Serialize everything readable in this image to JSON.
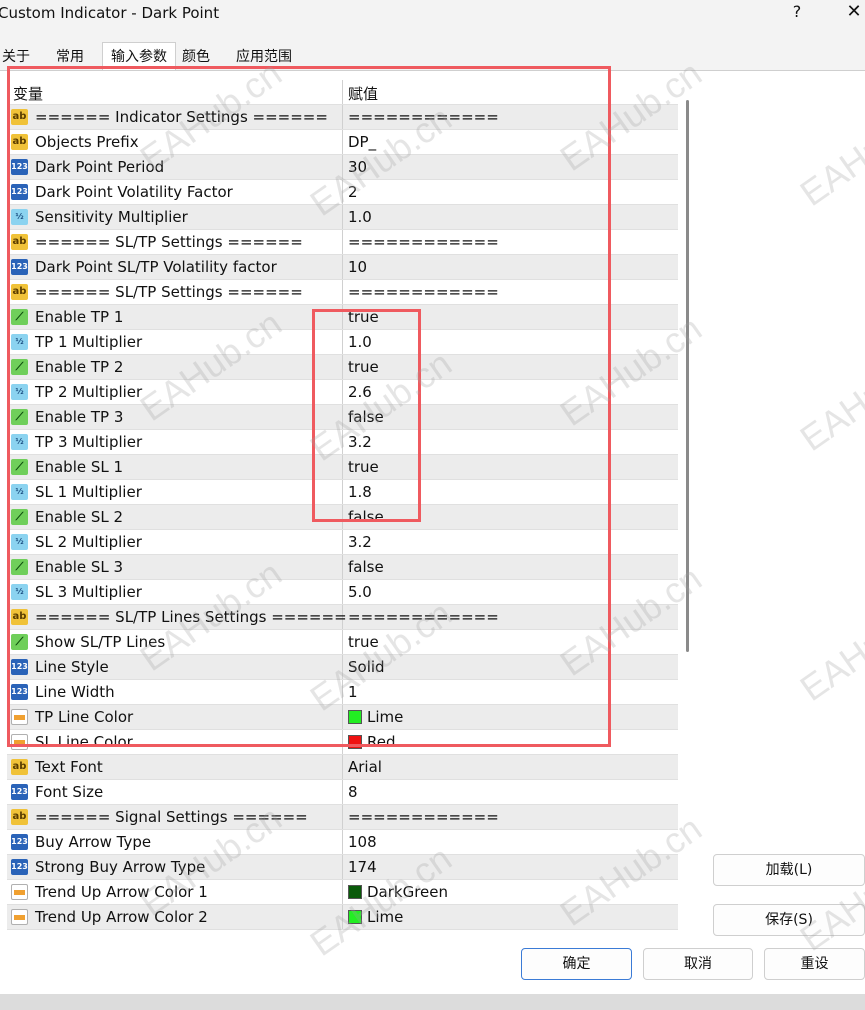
{
  "window": {
    "title": "Custom Indicator - Dark Point",
    "help": "?",
    "close": "✕"
  },
  "tabs": [
    "关于",
    "常用",
    "输入参数",
    "颜色",
    "应用范围"
  ],
  "grid": {
    "header": {
      "variable": "变量",
      "value": "赋值"
    },
    "rows": [
      {
        "icon": "ab",
        "name": "====== Indicator Settings ======",
        "value": "============"
      },
      {
        "icon": "ab",
        "name": "Objects Prefix",
        "value": "DP_"
      },
      {
        "icon": "123",
        "name": "Dark Point Period",
        "value": "30"
      },
      {
        "icon": "123",
        "name": "Dark Point Volatility Factor",
        "value": "2"
      },
      {
        "icon": "half",
        "name": "Sensitivity Multiplier",
        "value": "1.0"
      },
      {
        "icon": "ab",
        "name": "====== SL/TP Settings ======",
        "value": "============"
      },
      {
        "icon": "123",
        "name": "Dark Point SL/TP Volatility factor",
        "value": "10"
      },
      {
        "icon": "ab",
        "name": "====== SL/TP Settings ======",
        "value": "============"
      },
      {
        "icon": "bool",
        "name": "Enable TP 1",
        "value": "true"
      },
      {
        "icon": "half",
        "name": "TP 1 Multiplier",
        "value": "1.0"
      },
      {
        "icon": "bool",
        "name": "Enable TP 2",
        "value": "true"
      },
      {
        "icon": "half",
        "name": "TP 2 Multiplier",
        "value": "2.6"
      },
      {
        "icon": "bool",
        "name": "Enable TP 3",
        "value": "false"
      },
      {
        "icon": "half",
        "name": "TP 3 Multiplier",
        "value": "3.2"
      },
      {
        "icon": "bool",
        "name": "Enable SL 1",
        "value": "true"
      },
      {
        "icon": "half",
        "name": "SL 1 Multiplier",
        "value": "1.8"
      },
      {
        "icon": "bool",
        "name": "Enable SL 2",
        "value": "false"
      },
      {
        "icon": "half",
        "name": "SL 2 Multiplier",
        "value": "3.2"
      },
      {
        "icon": "bool",
        "name": "Enable SL 3",
        "value": "false"
      },
      {
        "icon": "half",
        "name": "SL 3 Multiplier",
        "value": "5.0"
      },
      {
        "icon": "ab",
        "name": "====== SL/TP Lines Settings ======",
        "value": "============"
      },
      {
        "icon": "bool",
        "name": "Show SL/TP Lines",
        "value": "true"
      },
      {
        "icon": "123",
        "name": "Line Style",
        "value": "Solid"
      },
      {
        "icon": "123",
        "name": "Line Width",
        "value": "1"
      },
      {
        "icon": "color",
        "name": "TP Line Color",
        "value": "Lime",
        "swatch": "#22ee22"
      },
      {
        "icon": "color",
        "name": "SL Line Color",
        "value": "Red",
        "swatch": "#ee1111"
      },
      {
        "icon": "ab",
        "name": "Text Font",
        "value": "Arial"
      },
      {
        "icon": "123",
        "name": "Font Size",
        "value": "8"
      },
      {
        "icon": "ab",
        "name": "====== Signal Settings ======",
        "value": "============"
      },
      {
        "icon": "123",
        "name": "Buy Arrow Type",
        "value": "108"
      },
      {
        "icon": "123",
        "name": "Strong Buy Arrow Type",
        "value": "174"
      },
      {
        "icon": "color",
        "name": "Trend Up Arrow Color 1",
        "value": "DarkGreen",
        "swatch": "#0a5a0a"
      },
      {
        "icon": "color",
        "name": "Trend Up Arrow Color 2",
        "value": "Lime",
        "swatch": "#22ee22"
      }
    ]
  },
  "side_buttons": {
    "load": "加载(L)",
    "save": "保存(S)"
  },
  "footer_buttons": {
    "ok": "确定",
    "cancel": "取消",
    "reset": "重设"
  },
  "watermark": "EAHub.cn",
  "colors": {
    "highlight_border": "#ef5a5f",
    "ok_border": "#3b7bd6"
  }
}
